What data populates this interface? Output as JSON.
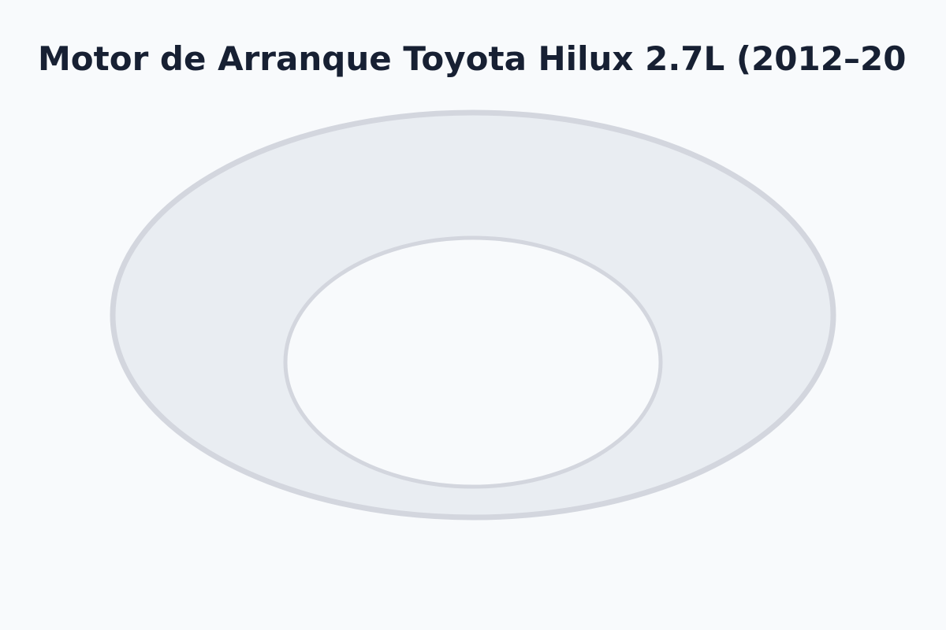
{
  "page": {
    "title": "Motor de Arranque Toyota Hilux 2.7L (2012–20"
  },
  "colors": {
    "background": "#f8fafc",
    "title_text": "#172033",
    "ring_fill": "#e9edf2",
    "ring_stroke": "#d3d6de"
  }
}
